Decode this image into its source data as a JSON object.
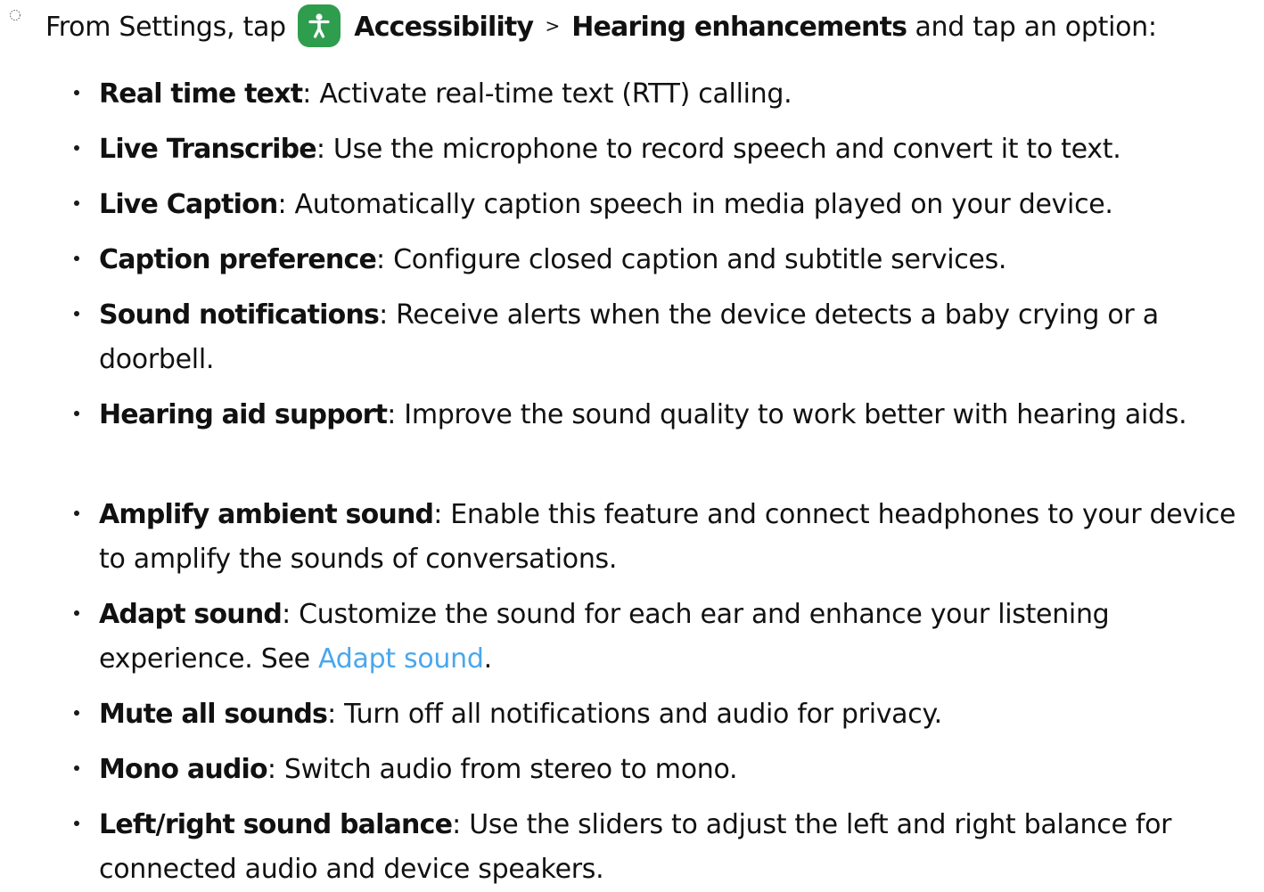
{
  "intro": {
    "prefix": "From Settings, tap",
    "app_icon": "accessibility-icon",
    "app_icon_color": "#2e9e4e",
    "menu": "Accessibility",
    "separator": ">",
    "submenu": "Hearing enhancements",
    "suffix": "and tap an option:"
  },
  "options": [
    {
      "term": "Real time text",
      "colon": ":",
      "desc": " Activate real-time text (RTT) calling."
    },
    {
      "term": "Live Transcribe",
      "colon": ":",
      "desc": " Use the microphone to record speech and convert it to text."
    },
    {
      "term": "Live Caption",
      "colon": ":",
      "desc": " Automatically caption speech in media played on your device."
    },
    {
      "term": "Caption preference",
      "colon": ":",
      "desc": " Configure closed caption and subtitle services."
    },
    {
      "term": "Sound notifications",
      "colon": ":",
      "desc": " Receive alerts when the device detects a baby crying or a doorbell."
    },
    {
      "term": "Hearing aid support",
      "colon": ":",
      "desc": " Improve the sound quality to work better with hearing aids."
    },
    {
      "term": "Amplify ambient sound",
      "colon": ":",
      "desc": " Enable this feature and connect headphones to your device to amplify the sounds of conversations."
    },
    {
      "term": "Adapt sound",
      "colon": ":",
      "desc": " Customize the sound for each ear and enhance your listening experience. See ",
      "link": "Adapt sound",
      "after": "."
    },
    {
      "term": "Mute all sounds",
      "colon": ":",
      "desc": " Turn off all notifications and audio for privacy."
    },
    {
      "term": "Mono audio",
      "colon": ":",
      "desc": " Switch audio from stereo to mono."
    },
    {
      "term": "Left/right sound balance",
      "colon": ":",
      "desc": " Use the sliders to adjust the left and right balance for connected audio and device speakers."
    }
  ],
  "colors": {
    "link": "#4aa7ec",
    "text": "#111111"
  }
}
